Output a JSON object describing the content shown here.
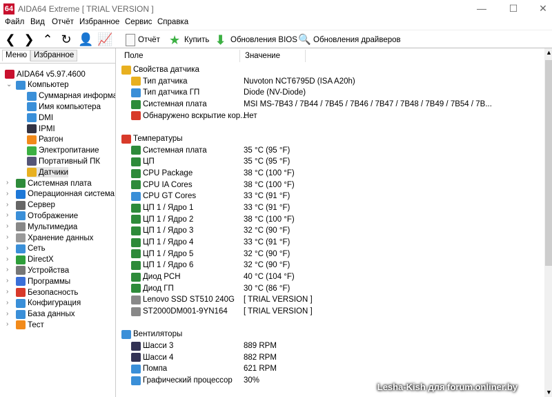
{
  "window": {
    "title": "AIDA64 Extreme  [ TRIAL VERSION ]",
    "logo": "64"
  },
  "menu": [
    "Файл",
    "Вид",
    "Отчёт",
    "Избранное",
    "Сервис",
    "Справка"
  ],
  "toolbar": {
    "report": "Отчёт",
    "buy": "Купить",
    "bios": "Обновления BIOS",
    "drivers": "Обновления драйверов"
  },
  "tabs": [
    "Меню",
    "Избранное"
  ],
  "tree": [
    {
      "label": "AIDA64 v5.97.4600",
      "level": 0,
      "icon": "aida-icon",
      "color": "#c8102e"
    },
    {
      "label": "Компьютер",
      "level": 1,
      "expanded": true,
      "icon": "computer-icon",
      "color": "#3a8fd8"
    },
    {
      "label": "Суммарная информаци",
      "level": 2,
      "icon": "monitor-icon",
      "color": "#3a8fd8"
    },
    {
      "label": "Имя компьютера",
      "level": 2,
      "icon": "monitor-icon",
      "color": "#3a8fd8"
    },
    {
      "label": "DMI",
      "level": 2,
      "icon": "monitor-icon",
      "color": "#3a8fd8"
    },
    {
      "label": "IPMI",
      "level": 2,
      "icon": "server-icon",
      "color": "#334"
    },
    {
      "label": "Разгон",
      "level": 2,
      "icon": "flame-icon",
      "color": "#f28a1a"
    },
    {
      "label": "Электропитание",
      "level": 2,
      "icon": "battery-icon",
      "color": "#3cb043"
    },
    {
      "label": "Портативный ПК",
      "level": 2,
      "icon": "laptop-icon",
      "color": "#557"
    },
    {
      "label": "Датчики",
      "level": 2,
      "icon": "gauge-icon",
      "color": "#e8b020",
      "selected": true
    },
    {
      "label": "Системная плата",
      "level": 1,
      "icon": "motherboard-icon",
      "color": "#2e8b3a"
    },
    {
      "label": "Операционная система",
      "level": 1,
      "icon": "windows-icon",
      "color": "#1e78d7"
    },
    {
      "label": "Сервер",
      "level": 1,
      "icon": "server-icon",
      "color": "#666"
    },
    {
      "label": "Отображение",
      "level": 1,
      "icon": "display-icon",
      "color": "#3a8fd8"
    },
    {
      "label": "Мультимедиа",
      "level": 1,
      "icon": "speaker-icon",
      "color": "#888"
    },
    {
      "label": "Хранение данных",
      "level": 1,
      "icon": "disk-icon",
      "color": "#999"
    },
    {
      "label": "Сеть",
      "level": 1,
      "icon": "network-icon",
      "color": "#3a8fd8"
    },
    {
      "label": "DirectX",
      "level": 1,
      "icon": "xbox-icon",
      "color": "#2e9e3a"
    },
    {
      "label": "Устройства",
      "level": 1,
      "icon": "devices-icon",
      "color": "#777"
    },
    {
      "label": "Программы",
      "level": 1,
      "icon": "programs-icon",
      "color": "#3a6fd8"
    },
    {
      "label": "Безопасность",
      "level": 1,
      "icon": "shield-icon",
      "color": "#d83a2a"
    },
    {
      "label": "Конфигурация",
      "level": 1,
      "icon": "config-icon",
      "color": "#3a8fd8"
    },
    {
      "label": "База данных",
      "level": 1,
      "icon": "database-icon",
      "color": "#3a8fd8"
    },
    {
      "label": "Тест",
      "level": 1,
      "icon": "test-icon",
      "color": "#f28a1a"
    }
  ],
  "columns": {
    "field": "Поле",
    "value": "Значение"
  },
  "rows": [
    {
      "group": true,
      "field": "Свойства датчика",
      "icon": "gauge-icon",
      "color": "#e8b020"
    },
    {
      "field": "Тип датчика",
      "value": "Nuvoton NCT6795D  (ISA A20h)",
      "icon": "gauge-icon",
      "color": "#e8b020"
    },
    {
      "field": "Тип датчика ГП",
      "value": "Diode  (NV-Diode)",
      "icon": "gpu-icon",
      "color": "#3a8fd8"
    },
    {
      "field": "Системная плата",
      "value": "MSI MS-7B43 / 7B44 / 7B45 / 7B46 / 7B47 / 7B48 / 7B49 / 7B54 / 7B...",
      "icon": "motherboard-icon",
      "color": "#2e8b3a"
    },
    {
      "field": "Обнаружено вскрытие кор...",
      "value": "Нет",
      "icon": "shield-icon",
      "color": "#d83a2a"
    },
    {
      "blank": true
    },
    {
      "group": true,
      "field": "Температуры",
      "icon": "thermometer-icon",
      "color": "#d83a2a"
    },
    {
      "field": "Системная плата",
      "value": "35 °C  (95 °F)",
      "icon": "motherboard-icon",
      "color": "#2e8b3a"
    },
    {
      "field": "ЦП",
      "value": "35 °C  (95 °F)",
      "icon": "cpu-icon",
      "color": "#2e8b3a"
    },
    {
      "field": "CPU Package",
      "value": "38 °C  (100 °F)",
      "icon": "cpu-icon",
      "color": "#2e8b3a"
    },
    {
      "field": "CPU IA Cores",
      "value": "38 °C  (100 °F)",
      "icon": "cpu-icon",
      "color": "#2e8b3a"
    },
    {
      "field": "CPU GT Cores",
      "value": "33 °C  (91 °F)",
      "icon": "gpu-icon",
      "color": "#3a8fd8"
    },
    {
      "field": "ЦП 1 / Ядро 1",
      "value": "33 °C  (91 °F)",
      "icon": "cpu-icon",
      "color": "#2e8b3a"
    },
    {
      "field": "ЦП 1 / Ядро 2",
      "value": "38 °C  (100 °F)",
      "icon": "cpu-icon",
      "color": "#2e8b3a"
    },
    {
      "field": "ЦП 1 / Ядро 3",
      "value": "32 °C  (90 °F)",
      "icon": "cpu-icon",
      "color": "#2e8b3a"
    },
    {
      "field": "ЦП 1 / Ядро 4",
      "value": "33 °C  (91 °F)",
      "icon": "cpu-icon",
      "color": "#2e8b3a"
    },
    {
      "field": "ЦП 1 / Ядро 5",
      "value": "32 °C  (90 °F)",
      "icon": "cpu-icon",
      "color": "#2e8b3a"
    },
    {
      "field": "ЦП 1 / Ядро 6",
      "value": "32 °C  (90 °F)",
      "icon": "cpu-icon",
      "color": "#2e8b3a"
    },
    {
      "field": "Диод PCH",
      "value": "40 °C  (104 °F)",
      "icon": "chip-icon",
      "color": "#2e8b3a"
    },
    {
      "field": "Диод ГП",
      "value": "30 °C  (86 °F)",
      "icon": "chip-icon",
      "color": "#2e8b3a"
    },
    {
      "field": "Lenovo  SSD  ST510  240G",
      "value": "[ TRIAL VERSION ]",
      "icon": "disk-icon",
      "color": "#888"
    },
    {
      "field": "ST2000DM001-9YN164",
      "value": "[ TRIAL VERSION ]",
      "icon": "disk-icon",
      "color": "#888"
    },
    {
      "blank": true
    },
    {
      "group": true,
      "field": "Вентиляторы",
      "icon": "fan-icon",
      "color": "#3a8fd8"
    },
    {
      "field": "Шасси 3",
      "value": "889 RPM",
      "icon": "case-icon",
      "color": "#335"
    },
    {
      "field": "Шасси 4",
      "value": "882 RPM",
      "icon": "case-icon",
      "color": "#335"
    },
    {
      "field": "Помпа",
      "value": "621 RPM",
      "icon": "fan-icon",
      "color": "#3a8fd8"
    },
    {
      "field": "Графический процессор",
      "value": "30%",
      "icon": "gpu-icon",
      "color": "#3a8fd8"
    }
  ],
  "watermark": "Lesha-Kish для forum.onliner.by"
}
